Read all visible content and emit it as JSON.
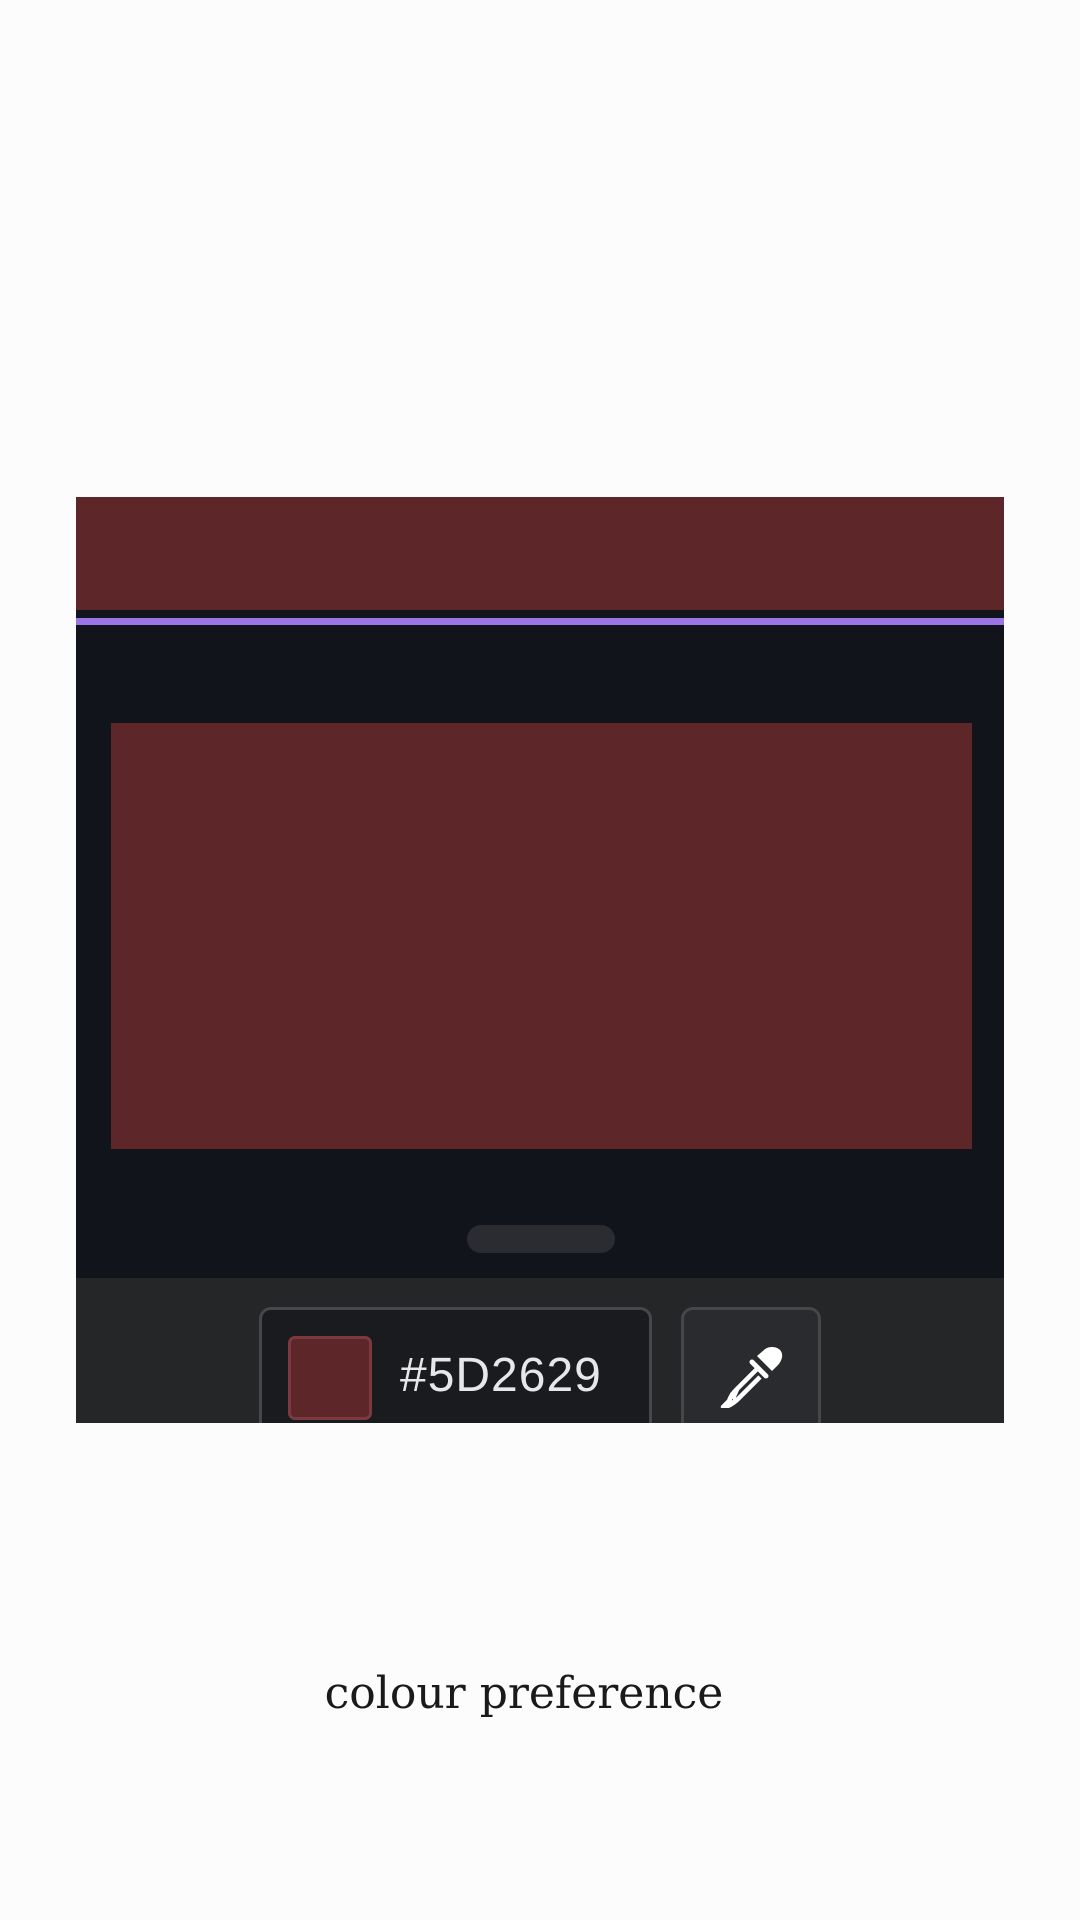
{
  "colors": {
    "selected": "#5D2629",
    "accent": "#9b74e8",
    "panel_background": "#11141a",
    "toolbar_background": "#252628"
  },
  "color_field": {
    "hex_value": "#5D2629"
  },
  "icons": {
    "eyedropper": "eyedropper-icon"
  },
  "caption": {
    "text": "colour preference"
  }
}
